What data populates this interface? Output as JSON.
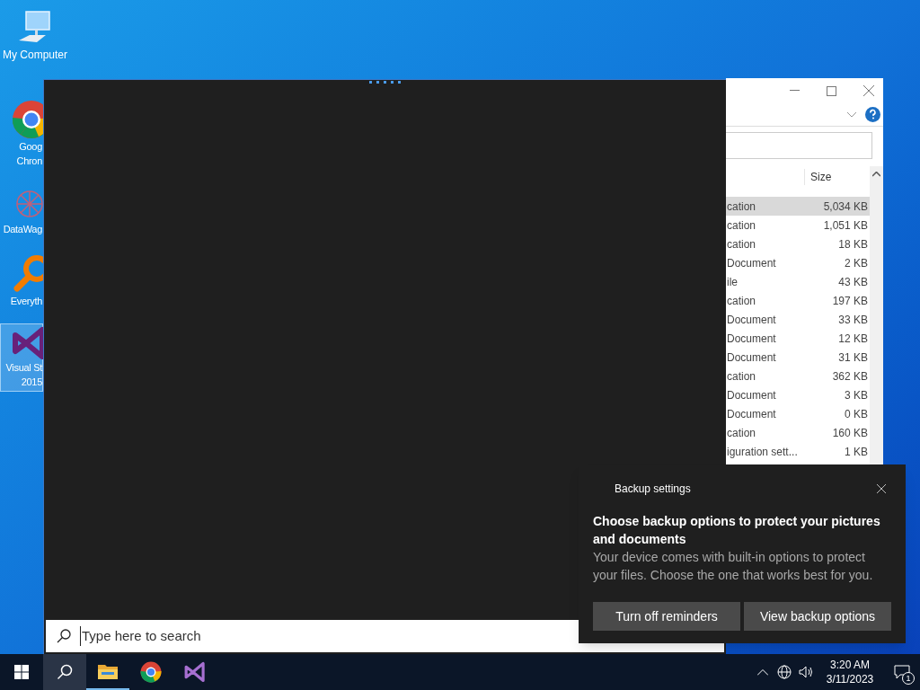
{
  "desktop_icons": [
    {
      "kind": "computer",
      "lines": [
        "My Computer"
      ],
      "selected": false
    },
    {
      "kind": "chrome",
      "lines": [
        "Goog",
        "Chron"
      ],
      "selected": false
    },
    {
      "kind": "datawagon",
      "lines": [
        "DataWag"
      ],
      "selected": false
    },
    {
      "kind": "everything",
      "lines": [
        "Everyth"
      ],
      "selected": false
    },
    {
      "kind": "visualstudio",
      "lines": [
        "Visual St",
        "2015"
      ],
      "selected": true
    }
  ],
  "explorer": {
    "column": "Size",
    "rows": [
      {
        "type": "cation",
        "size": "5,034 KB",
        "selected": true
      },
      {
        "type": "cation",
        "size": "1,051 KB",
        "selected": false
      },
      {
        "type": "cation",
        "size": "18 KB",
        "selected": false
      },
      {
        "type": "Document",
        "size": "2 KB",
        "selected": false
      },
      {
        "type": "ile",
        "size": "43 KB",
        "selected": false
      },
      {
        "type": "cation",
        "size": "197 KB",
        "selected": false
      },
      {
        "type": "Document",
        "size": "33 KB",
        "selected": false
      },
      {
        "type": "Document",
        "size": "12 KB",
        "selected": false
      },
      {
        "type": "Document",
        "size": "31 KB",
        "selected": false
      },
      {
        "type": "cation",
        "size": "362 KB",
        "selected": false
      },
      {
        "type": "Document",
        "size": "3 KB",
        "selected": false
      },
      {
        "type": "Document",
        "size": "0 KB",
        "selected": false
      },
      {
        "type": "cation",
        "size": "160 KB",
        "selected": false
      },
      {
        "type": "iguration sett...",
        "size": "1 KB",
        "selected": false
      }
    ]
  },
  "search_panel": {
    "placeholder": "Type here to search"
  },
  "notification": {
    "app": "Backup settings",
    "title": "Choose backup options to protect your pictures and documents",
    "body": "Your device comes with built-in options to protect your files. Choose the one that works best for you.",
    "buttons": [
      "Turn off reminders",
      "View backup options"
    ]
  },
  "taskbar": {
    "apps": [
      {
        "kind": "start",
        "active": false,
        "running": false
      },
      {
        "kind": "search",
        "active": true,
        "running": false
      },
      {
        "kind": "folder",
        "active": false,
        "running": true
      },
      {
        "kind": "chrome",
        "active": false,
        "running": false
      },
      {
        "kind": "visualstudio",
        "active": false,
        "running": false
      }
    ],
    "time": "3:20 AM",
    "date": "3/11/2023",
    "notification_count": "1"
  }
}
